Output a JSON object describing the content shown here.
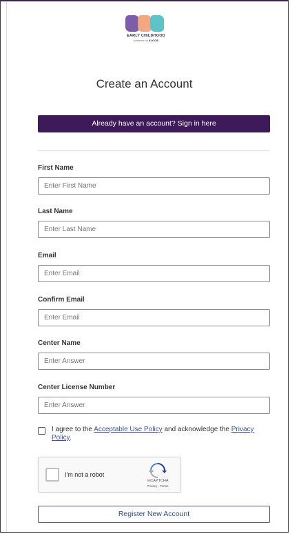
{
  "logo": {
    "line1": "EARLY CHILDHOOD",
    "line2_prefix": "powered by",
    "line2_brand": "KLOOE",
    "colors": [
      "#7b5ea7",
      "#f2a37d",
      "#5ec3c7"
    ]
  },
  "title": "Create an Account",
  "signin_label": "Already have an account? Sign in here",
  "fields": [
    {
      "label": "First Name",
      "placeholder": "Enter First Name"
    },
    {
      "label": "Last Name",
      "placeholder": "Enter Last Name"
    },
    {
      "label": "Email",
      "placeholder": "Enter Email"
    },
    {
      "label": "Confirm Email",
      "placeholder": "Enter Email"
    },
    {
      "label": "Center Name",
      "placeholder": "Enter Answer"
    },
    {
      "label": "Center License Number",
      "placeholder": "Enter Answer"
    }
  ],
  "agree": {
    "prefix": "I agree to the ",
    "link1": "Acceptable Use Policy",
    "middle": " and acknowledge the ",
    "link2": "Privacy Policy",
    "suffix": "."
  },
  "captcha": {
    "label": "I'm not a robot",
    "brand": "reCAPTCHA",
    "links": "Privacy - Terms"
  },
  "register_label": "Register New Account",
  "colors": {
    "brand_purple": "#3f1a5a",
    "link_blue": "#3a4fa8"
  }
}
